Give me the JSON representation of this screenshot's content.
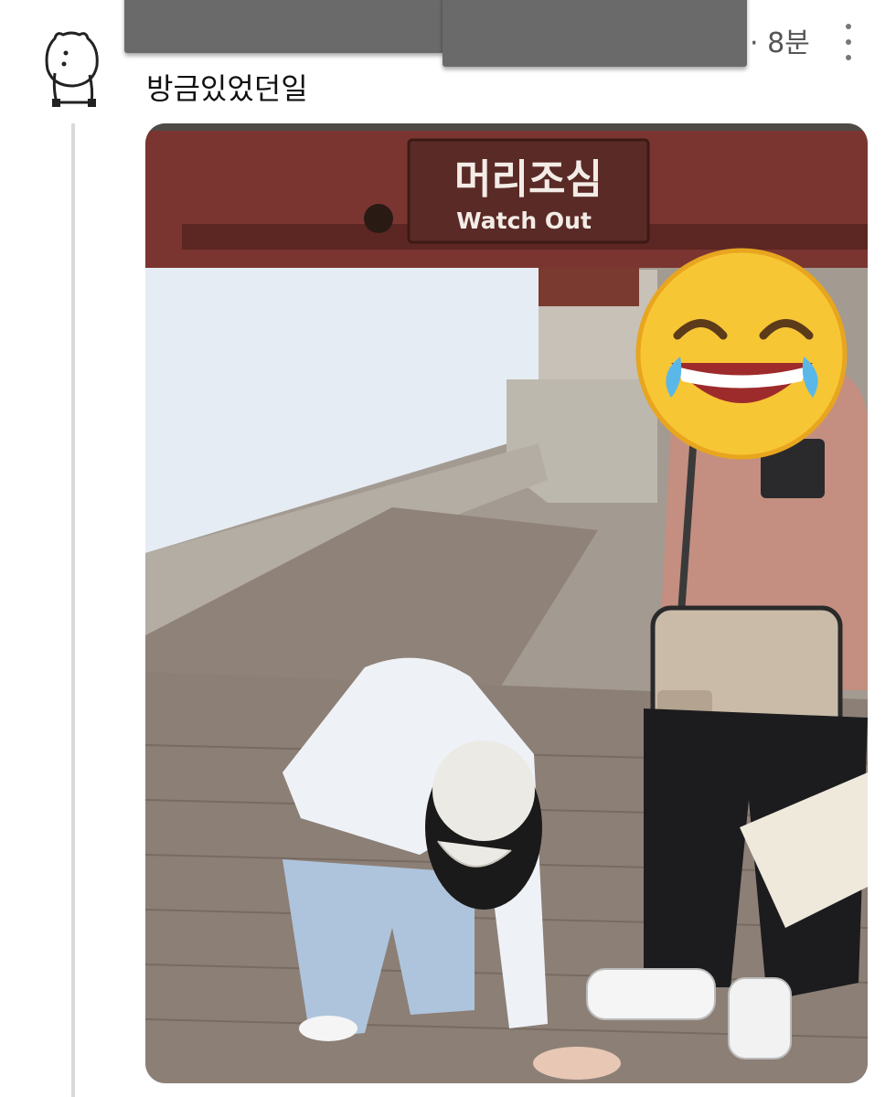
{
  "post": {
    "text": "방금있었던일",
    "time": "· 8분",
    "avatar_icon": "bear-avatar-icon",
    "more_icon": "vertical-dots-icon"
  },
  "photo": {
    "sign_korean": "머리조심",
    "sign_english": "Watch Out",
    "emoji_icon": "laughing-crying-emoji-icon"
  },
  "colors": {
    "background": "#ffffff",
    "timestamp": "#555555",
    "sign": "#6b2e29",
    "emoji": "#f7c634"
  }
}
